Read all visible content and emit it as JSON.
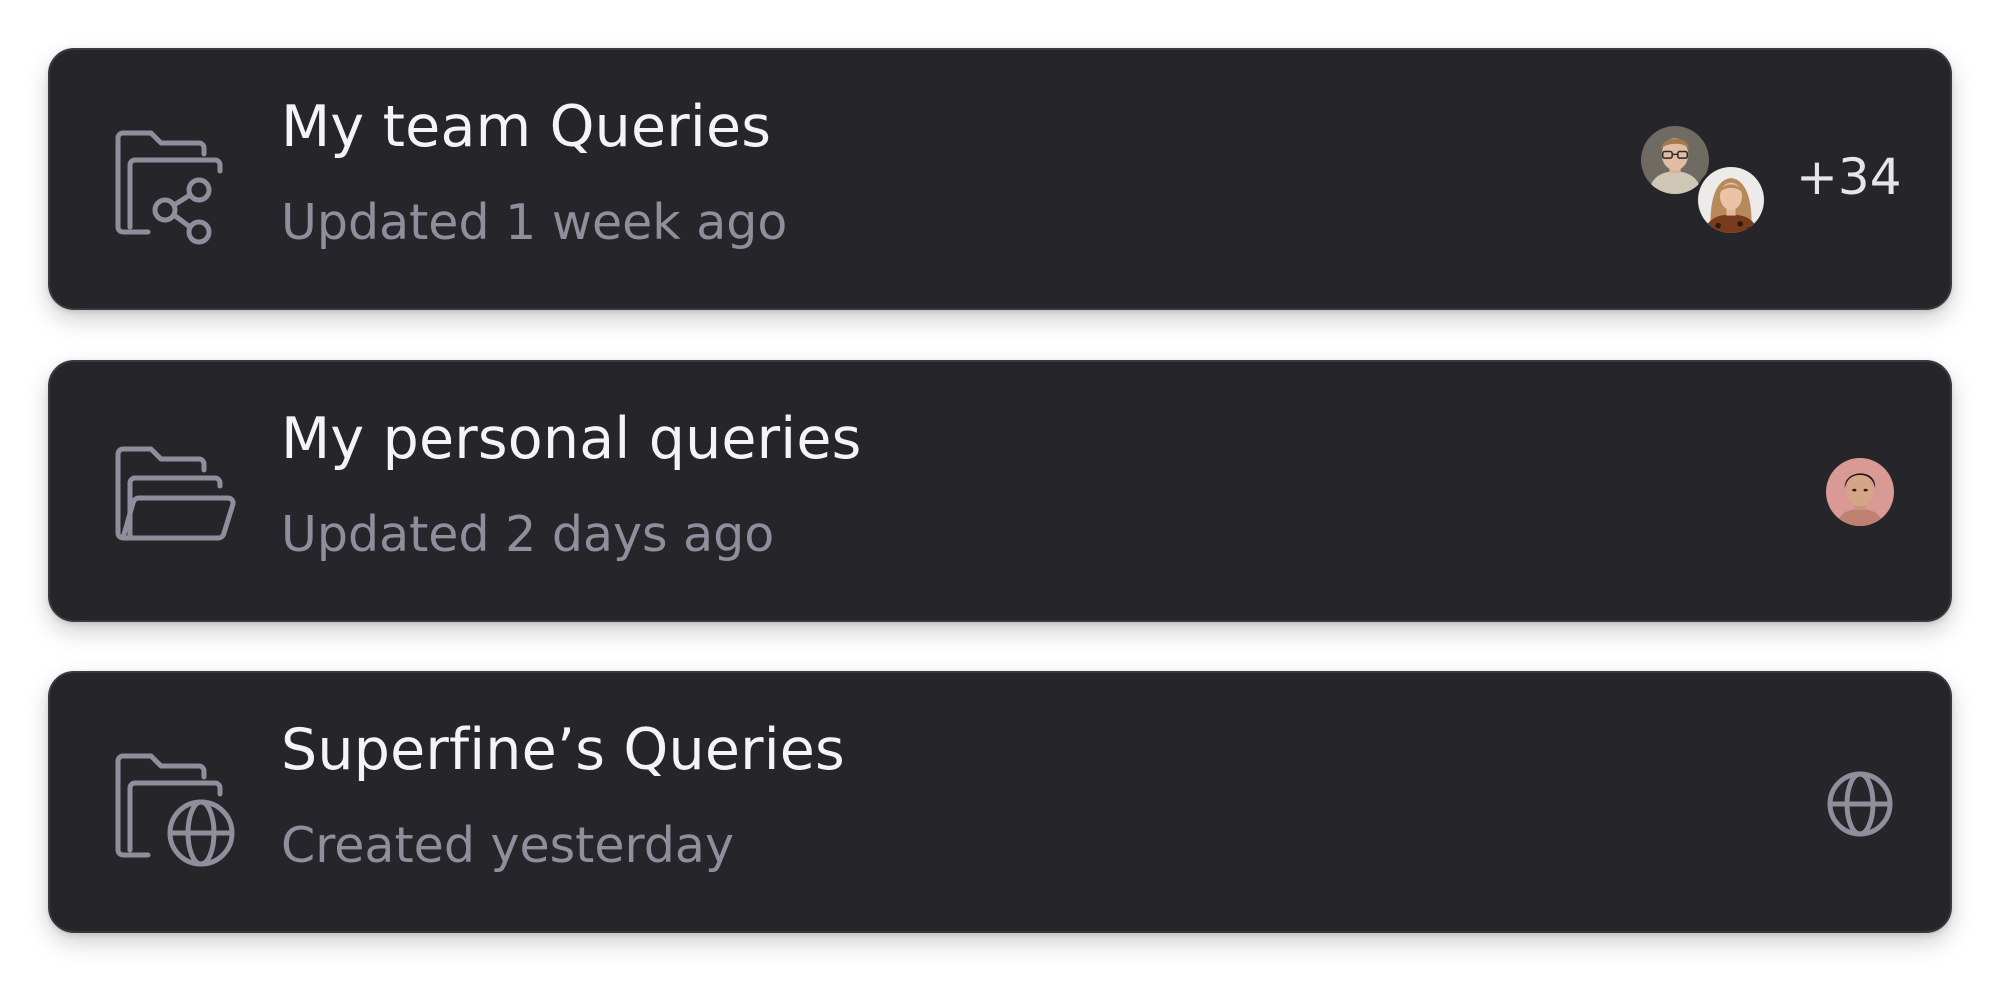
{
  "colors": {
    "card_background": "#26252a",
    "card_border": "#3a3940",
    "title_text": "#f4f4f6",
    "subtitle_text": "#8f8e9c",
    "icon_stroke": "#8f8e9c"
  },
  "folders": [
    {
      "title": "My team Queries",
      "subtitle": "Updated 1 week ago",
      "icon": "folder-share-icon",
      "members": [
        "avatar-man-glasses",
        "avatar-woman-blonde"
      ],
      "more_count": "+34"
    },
    {
      "title": "My personal queries",
      "subtitle": "Updated 2 days ago",
      "icon": "folder-open-icon",
      "members": [
        "avatar-person-dark-hair"
      ]
    },
    {
      "title": "Superfine’s Queries",
      "subtitle": "Created yesterday",
      "icon": "folder-globe-icon",
      "visibility_icon": "globe-icon"
    }
  ]
}
